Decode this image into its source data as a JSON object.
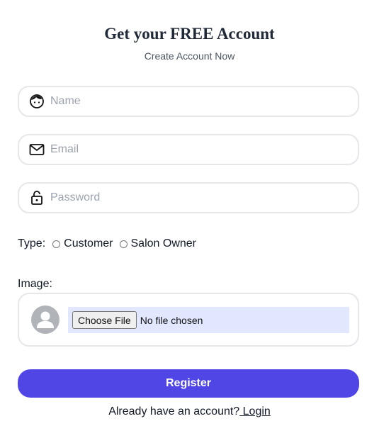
{
  "header": {
    "title": "Get your FREE Account",
    "subtitle": "Create Account Now"
  },
  "form": {
    "name": {
      "placeholder": "Name",
      "value": "",
      "icon": "face-icon"
    },
    "email": {
      "placeholder": "Email",
      "value": "",
      "icon": "envelope-icon"
    },
    "password": {
      "placeholder": "Password",
      "value": "",
      "icon": "lock-icon"
    },
    "type": {
      "label": "Type:",
      "options": [
        "Customer",
        "Salon Owner"
      ],
      "selected": null
    },
    "image": {
      "label": "Image:",
      "button_label": "Choose File",
      "status": "No file chosen",
      "avatar_icon": "user-avatar-icon"
    },
    "submit_label": "Register"
  },
  "footer": {
    "text": "Already have an account?",
    "link": " Login"
  },
  "colors": {
    "primary": "#4f46e5",
    "file_area_bg": "#e0e7ff",
    "border": "#e5e7eb"
  }
}
